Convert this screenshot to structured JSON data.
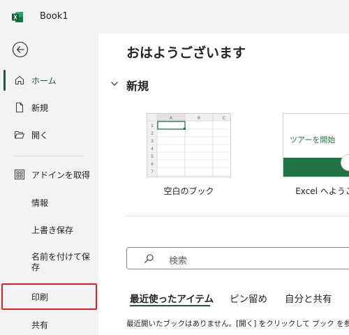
{
  "titlebar": {
    "doc_title": "Book1"
  },
  "sidebar": {
    "items": [
      {
        "label": "ホーム",
        "icon": "home-icon",
        "active": true
      },
      {
        "label": "新規",
        "icon": "new-document-icon"
      },
      {
        "label": "開く",
        "icon": "folder-open-icon"
      },
      {
        "label": "アドインを取得",
        "icon": "add-ins-grid-icon"
      },
      {
        "label": "情報"
      },
      {
        "label": "上書き保存"
      },
      {
        "label": "名前を付けて保存"
      },
      {
        "label": "印刷",
        "highlighted": true
      },
      {
        "label": "共有"
      }
    ]
  },
  "main": {
    "greeting": "おはようございます",
    "new_section": {
      "heading": "新規",
      "templates": [
        {
          "label": "空白のブック"
        },
        {
          "label": "Excel へようこ",
          "thumb_text": "ツアーを開始"
        }
      ]
    },
    "search": {
      "placeholder": "検索"
    },
    "tabs": [
      {
        "label": "最近使ったアイテム",
        "active": true
      },
      {
        "label": "ピン留め"
      },
      {
        "label": "自分と共有"
      }
    ],
    "empty_message": "最近開いたブックはありません。[開く] をクリックして ブック を参照しま"
  },
  "colors": {
    "brand_green": "#185c37",
    "excel_green": "#217346",
    "highlight_red": "#e02020"
  }
}
